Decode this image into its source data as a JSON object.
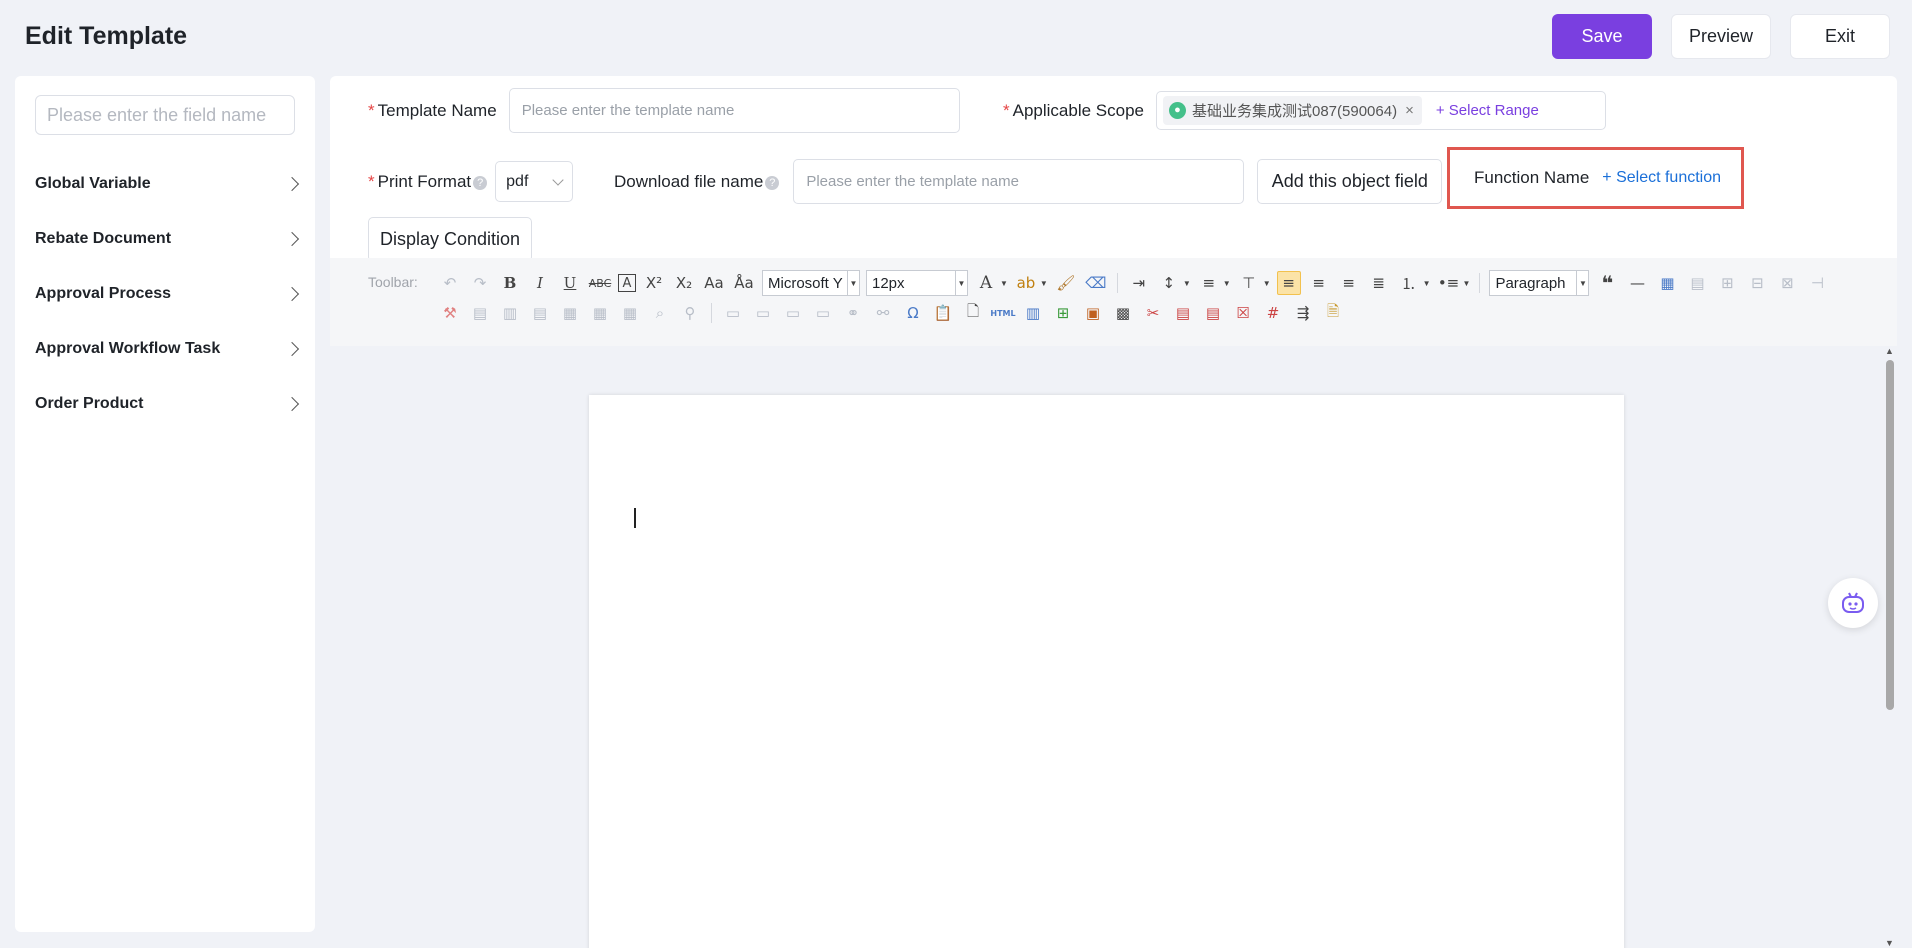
{
  "header": {
    "title": "Edit Template",
    "save_label": "Save",
    "preview_label": "Preview",
    "exit_label": "Exit"
  },
  "sidebar": {
    "search_placeholder": "Please enter the field name",
    "items": [
      {
        "label": "Global Variable"
      },
      {
        "label": "Rebate Document"
      },
      {
        "label": "Approval Process"
      },
      {
        "label": "Approval Workflow Task"
      },
      {
        "label": "Order Product"
      }
    ]
  },
  "form": {
    "template_name_label": "Template Name",
    "template_name_placeholder": "Please enter the template name",
    "scope_label": "Applicable Scope",
    "scope_tag": "基础业务集成测试087(590064)",
    "select_range_label": "+ Select Range",
    "print_format_label": "Print Format",
    "print_format_value": "pdf",
    "download_label": "Download file name",
    "download_placeholder": "Please enter the template name",
    "add_field_label": "Add this object field",
    "function_name_label": "Function Name",
    "select_function_label": "+ Select function",
    "display_condition_label": "Display Condition"
  },
  "toolbar": {
    "label": "Toolbar:",
    "font_family": "Microsoft Y",
    "font_size": "12px",
    "paragraph": "Paragraph"
  },
  "colors": {
    "primary": "#7a3fe0",
    "link_blue": "#1a6fd8",
    "highlight_border": "#e0574f",
    "required": "#e54545"
  }
}
